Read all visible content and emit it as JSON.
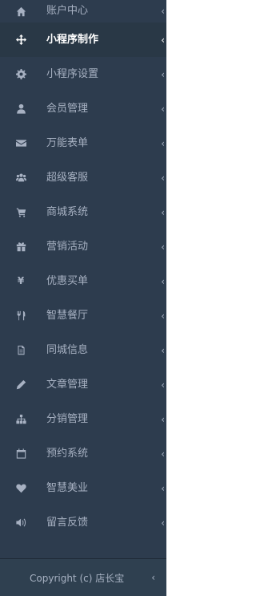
{
  "menu": {
    "items": [
      {
        "label": "账户中心",
        "icon": "home-icon"
      },
      {
        "label": "小程序制作",
        "icon": "move-icon",
        "active": true
      },
      {
        "label": "小程序设置",
        "icon": "gear-icon"
      },
      {
        "label": "会员管理",
        "icon": "user-icon"
      },
      {
        "label": "万能表单",
        "icon": "envelope-icon"
      },
      {
        "label": "超级客服",
        "icon": "users-icon"
      },
      {
        "label": "商城系统",
        "icon": "cart-icon"
      },
      {
        "label": "营销活动",
        "icon": "gift-icon"
      },
      {
        "label": "优惠买单",
        "icon": "yen-icon"
      },
      {
        "label": "智慧餐厅",
        "icon": "cutlery-icon"
      },
      {
        "label": "同城信息",
        "icon": "document-icon"
      },
      {
        "label": "文章管理",
        "icon": "pencil-icon"
      },
      {
        "label": "分销管理",
        "icon": "sitemap-icon"
      },
      {
        "label": "预约系统",
        "icon": "calendar-icon"
      },
      {
        "label": "智慧美业",
        "icon": "heart-icon"
      },
      {
        "label": "留言反馈",
        "icon": "volume-icon"
      }
    ],
    "chevron": "‹",
    "yen_glyph": "¥"
  },
  "footer": {
    "copyright": "Copyright (c) 店长宝",
    "chevron": "‹"
  },
  "colors": {
    "sidebar_bg": "#2d3c4e",
    "text": "#a7b1c2",
    "active_text": "#ffffff"
  }
}
